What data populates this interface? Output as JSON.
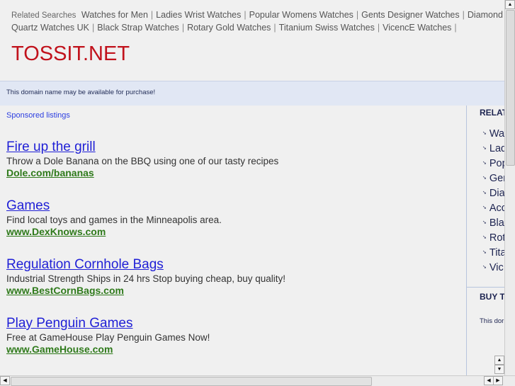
{
  "related_searches": {
    "label": "Related Searches",
    "items": [
      "Watches for Men",
      "Ladies Wrist Watches",
      "Popular Womens Watches",
      "Gents Designer Watches",
      "Diamond Quartz Watches UK",
      "Black Strap Watches",
      "Rotary Gold Watches",
      "Titanium Swiss Watches",
      "VicencE Watches"
    ]
  },
  "logo": "TOSSIT.NET",
  "notice": "This domain name may be available for purchase!",
  "sponsored_label": "Sponsored listings",
  "ads": [
    {
      "title": "Fire up the grill",
      "desc": "Throw a Dole Banana on the BBQ using one of our tasty recipes",
      "url": "Dole.com/bananas"
    },
    {
      "title": "Games",
      "desc": "Find local toys and games in the Minneapolis area.",
      "url": "www.DexKnows.com"
    },
    {
      "title": "Regulation Cornhole Bags",
      "desc": "Industrial Strength Ships in 24 hrs Stop buying cheap, buy quality!",
      "url": "www.BestCornBags.com"
    },
    {
      "title": "Play Penguin Games",
      "desc": "Free at GameHouse Play Penguin Games Now!",
      "url": "www.GameHouse.com"
    }
  ],
  "sidebar": {
    "related_title": "RELAT",
    "items": [
      "Wa",
      "Lad",
      "Pop",
      "Ger",
      "Dia",
      "Acc",
      "Bla",
      "Rot",
      "Tita",
      "Vic"
    ],
    "buy_title": "BUY T",
    "buy_text": "This dor"
  }
}
